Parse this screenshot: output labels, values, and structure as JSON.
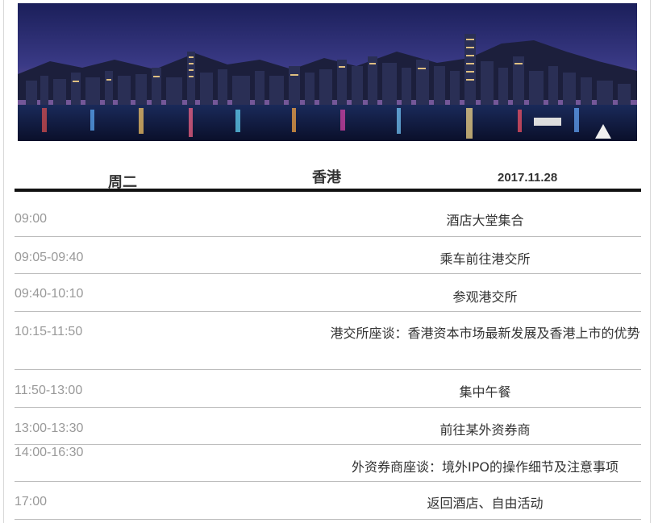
{
  "header": {
    "day": "周二",
    "city": "香港",
    "date": "2017.11.28"
  },
  "banner": {
    "alt": "Hong Kong night skyline"
  },
  "schedule": [
    {
      "time": "09:00",
      "event": "酒店大堂集合"
    },
    {
      "time": "09:05-09:40",
      "event": "乘车前往港交所"
    },
    {
      "time": "09:40-10:10",
      "event": "参观港交所"
    },
    {
      "time": "10:15-11:50",
      "event": "港交所座谈：香港资本市场最新发展及香港上市的优势"
    },
    {
      "time": "11:50-13:00",
      "event": "集中午餐"
    },
    {
      "time": "13:00-13:30",
      "event": "前往某外资券商"
    },
    {
      "time": "14:00-16:30",
      "event": "外资券商座谈：境外IPO的操作细节及注意事项"
    },
    {
      "time": "17:00",
      "event": "返回酒店、自由活动"
    }
  ]
}
